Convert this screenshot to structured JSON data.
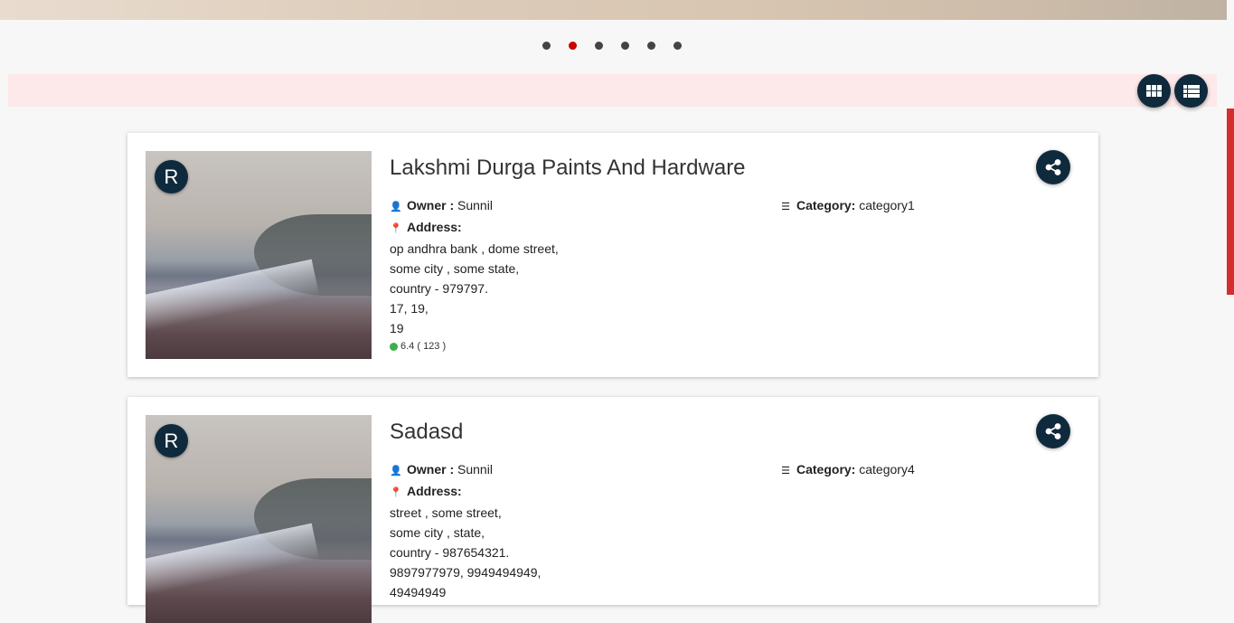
{
  "carousel": {
    "slide_count": 6,
    "active_index": 1
  },
  "toolbar": {
    "grid_view_icon": "grid-icon",
    "list_view_icon": "list-icon"
  },
  "labels": {
    "owner": "Owner :",
    "address": "Address:",
    "category": "Category:"
  },
  "listings": [
    {
      "avatar": "R",
      "title": "Lakshmi Durga Paints And Hardware",
      "owner": "Sunnil",
      "address_lines": [
        "op andhra bank , dome street,",
        "some city , some state,",
        "country - 979797.",
        "17, 19,",
        "19"
      ],
      "rating": "6.4 ( 123 )",
      "category": "category1"
    },
    {
      "avatar": "R",
      "title": "Sadasd",
      "owner": "Sunnil",
      "address_lines": [
        "street , some street,",
        "some city , state,",
        "country - 987654321.",
        "9897977979, 9949494949,",
        "49494949"
      ],
      "category": "category4"
    }
  ]
}
